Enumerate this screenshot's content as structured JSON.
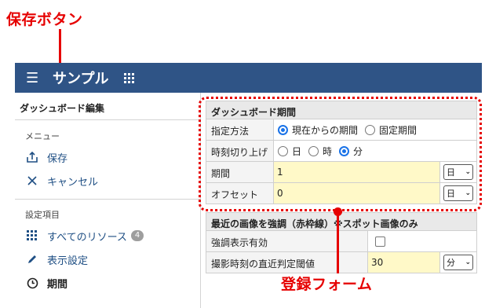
{
  "annotations": {
    "save_button_callout": "保存ボタン",
    "form_callout": "登録フォーム"
  },
  "header": {
    "app_title": "サンプル",
    "bg_color": "#2f5486"
  },
  "sidebar": {
    "heading": "ダッシュボード編集",
    "menu_section": "メニュー",
    "menu_items": [
      {
        "label": "保存",
        "icon": "save-icon"
      },
      {
        "label": "キャンセル",
        "icon": "close-icon"
      }
    ],
    "settings_section": "設定項目",
    "settings_items": [
      {
        "label": "すべてのリソース",
        "icon": "grid-icon",
        "badge": "4"
      },
      {
        "label": "表示設定",
        "icon": "pencil-icon"
      },
      {
        "label": "期間",
        "icon": "clock-icon"
      }
    ]
  },
  "period_form": {
    "title": "ダッシュボード期間",
    "rows": {
      "method_label": "指定方法",
      "method_options": [
        "現在からの期間",
        "固定期間"
      ],
      "method_selected": "現在からの期間",
      "round_label": "時刻切り上げ",
      "round_options": [
        "日",
        "時",
        "分"
      ],
      "round_selected": "分",
      "period_label": "期間",
      "period_value": "1",
      "period_unit": "日",
      "offset_label": "オフセット",
      "offset_value": "0",
      "offset_unit": "日"
    }
  },
  "highlight_form": {
    "title": "最近の画像を強調（赤枠線）※スポット画像のみ",
    "enable_label": "強調表示有効",
    "enable_checked": false,
    "threshold_label": "撮影時刻の直近判定閾値",
    "threshold_value": "30",
    "threshold_unit": "分"
  }
}
